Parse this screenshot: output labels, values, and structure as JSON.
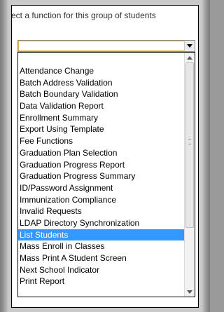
{
  "heading": "ect a function for this group of students",
  "select": {
    "value": ""
  },
  "options": [
    "Attendance Change",
    "Batch Address Validation",
    "Batch Boundary Validation",
    "Data Validation Report",
    "Enrollment Summary",
    "Export Using Template",
    "Fee Functions",
    "Graduation Plan Selection",
    "Graduation Progress Report",
    "Graduation Progress Summary",
    "ID/Password Assignment",
    "Immunization Compliance",
    "Invalid Requests",
    "LDAP Directory Synchronization",
    "List Students",
    "Mass Enroll in Classes",
    "Mass Print A Student Screen",
    "Next School Indicator",
    "Print Report"
  ],
  "selected_option": "List Students",
  "colors": {
    "highlight": "#3399ff"
  }
}
